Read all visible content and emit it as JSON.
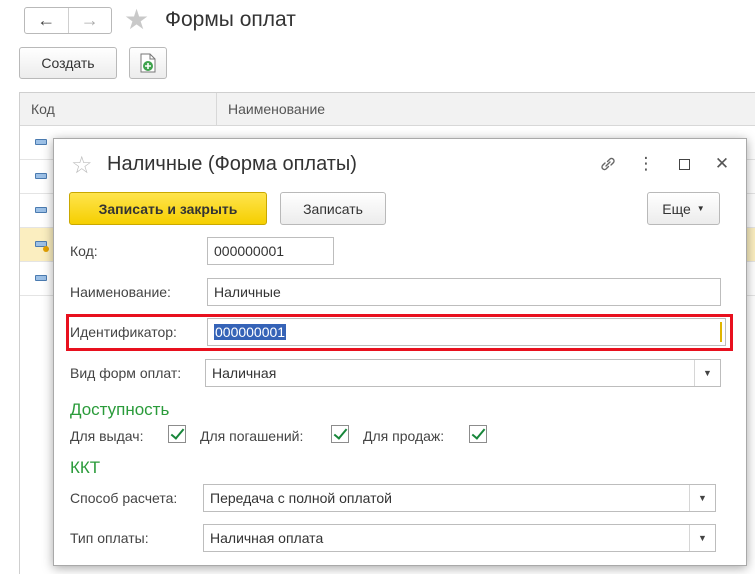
{
  "main": {
    "title": "Формы оплат",
    "create_label": "Создать",
    "columns": [
      "Код",
      "Наименование"
    ]
  },
  "dialog": {
    "title": "Наличные (Форма оплаты)",
    "save_close_label": "Записать и закрыть",
    "save_label": "Записать",
    "more_label": "Еще",
    "fields": {
      "code": {
        "label": "Код:",
        "value": "000000001"
      },
      "name": {
        "label": "Наименование:",
        "value": "Наличные"
      },
      "identifier": {
        "label": "Идентификатор:",
        "value": "000000001"
      },
      "payment_kind": {
        "label": "Вид форм оплат:",
        "value": "Наличная"
      }
    },
    "availability": {
      "header": "Доступность",
      "issue_label": "Для выдач:",
      "repay_label": "Для погашений:",
      "sales_label": "Для продаж:"
    },
    "kkt": {
      "header": "ККТ",
      "settlement_label": "Способ расчета:",
      "settlement_value": "Передача с полной оплатой",
      "payment_type_label": "Тип оплаты:",
      "payment_type_value": "Наличная оплата"
    }
  },
  "colors": {
    "accent_yellow": "#f5cf00",
    "section_green": "#2a9b3a",
    "highlight_red": "#e8101e",
    "selection_blue": "#3563b7"
  }
}
